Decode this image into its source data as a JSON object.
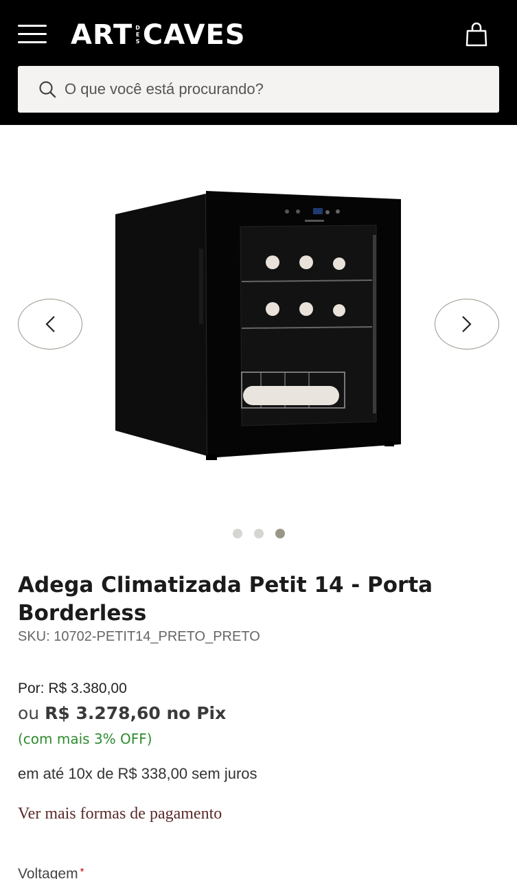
{
  "header": {
    "logo_left": "ART",
    "logo_des": [
      "D",
      "E",
      "S"
    ],
    "logo_right": "CAVES"
  },
  "search": {
    "placeholder": "O que você está procurando?"
  },
  "gallery": {
    "dots": 3,
    "active_dot": 3,
    "image": "wine-cooler-product-photo"
  },
  "product": {
    "title": "Adega Climatizada Petit 14 - Porta Borderless",
    "sku": "SKU: 10702-PETIT14_PRETO_PRETO",
    "price_por": "Por: R$ 3.380,00",
    "pix_prefix": "ou",
    "pix_price": "R$ 3.278,60 no Pix",
    "discount": "(com mais 3% OFF)",
    "installments": "em até 10x de R$ 338,00 sem juros",
    "payments_link": "Ver mais formas de pagamento"
  },
  "options": {
    "voltage_label": "Voltagem",
    "required_mark": "*"
  },
  "colors": {
    "header_bg": "#000000",
    "discount": "#2e8b2e",
    "link": "#5a2a2a"
  }
}
